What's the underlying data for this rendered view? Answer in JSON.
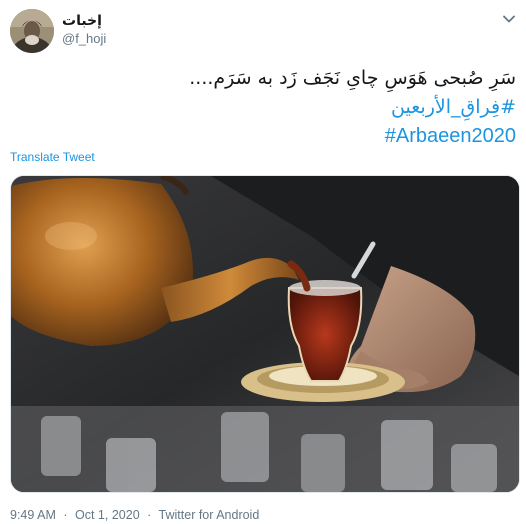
{
  "tweet": {
    "display_name": "إخبات",
    "username": "@f_hoji",
    "text_line": "سَرِ صُبحی هَوَسِ چایِ نَجَف زَد به سَرَم....",
    "hashtags": [
      "#فِراقِ_الأربعین",
      "#Arbaeen2020"
    ],
    "translate_label": "Translate Tweet",
    "time": "9:49 AM",
    "date": "Oct 1, 2020",
    "source": "Twitter for Android",
    "separator": "·"
  },
  "icons": {
    "menu": "chevron-down-icon",
    "avatar": "profile-avatar"
  },
  "colors": {
    "link": "#1b95e0",
    "muted": "#657786",
    "text": "#14171a"
  }
}
